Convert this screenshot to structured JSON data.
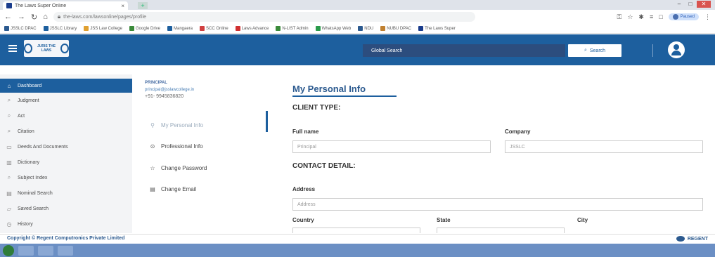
{
  "browser": {
    "tab_title": "The Laws Super Online",
    "tab_close": "×",
    "new_tab": "+",
    "url": "the-laws.com/lawsonline/pages/profile",
    "paused_label": "Paused",
    "bookmarks": [
      "JSSLC DPAC",
      "JSSLC Library",
      "JSS Law College",
      "Google Drive",
      "Mangaera",
      "SCC Online",
      "Laws Advance",
      "N-LIST Admin",
      "WhatsApp Web",
      "NDU",
      "NUBU DPAC",
      "The Laws Super"
    ]
  },
  "header": {
    "logo_text": "JURIS THE LAWS",
    "global_search": "Global Search",
    "search_button": "Search"
  },
  "sidebar": {
    "items": [
      {
        "label": "Dashboard",
        "icon": "home-icon"
      },
      {
        "label": "Judgment",
        "icon": "search-icon"
      },
      {
        "label": "Act",
        "icon": "search-icon"
      },
      {
        "label": "Citation",
        "icon": "search-icon"
      },
      {
        "label": "Deeds And Documents",
        "icon": "document-icon"
      },
      {
        "label": "Dictionary",
        "icon": "book-icon"
      },
      {
        "label": "Subject Index",
        "icon": "search-icon"
      },
      {
        "label": "Nominal Search",
        "icon": "list-icon"
      },
      {
        "label": "Saved Search",
        "icon": "folder-icon"
      },
      {
        "label": "History",
        "icon": "clock-icon"
      }
    ]
  },
  "profile": {
    "role": "PRINCIPAL",
    "email": "principal@jsslawcollege.in",
    "phone": "+91- 9945836820",
    "menu": [
      {
        "label": "My Personal Info",
        "icon": "person-icon"
      },
      {
        "label": "Professional Info",
        "icon": "info-icon"
      },
      {
        "label": "Change Password",
        "icon": "star-icon"
      },
      {
        "label": "Change Email",
        "icon": "email-icon"
      }
    ]
  },
  "main": {
    "title": "My Personal Info",
    "client_type": "CLIENT TYPE:",
    "full_name_label": "Full name",
    "full_name_value": "Principal",
    "company_label": "Company",
    "company_value": "JSSLC",
    "contact_detail": "CONTACT DETAIL:",
    "address_label": "Address",
    "address_placeholder": "Address",
    "country_label": "Country",
    "state_label": "State",
    "city_label": "City"
  },
  "footer": {
    "copyright": "Copyright © Regent Computronics Private Limited",
    "brand": "REGENT"
  }
}
